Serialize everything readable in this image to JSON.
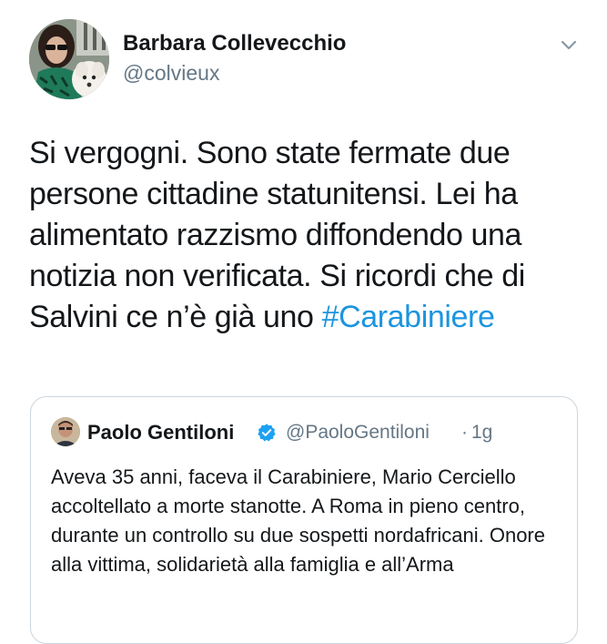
{
  "tweet": {
    "author": {
      "name": "Barbara Collevecchio",
      "handle": "@colvieux"
    },
    "text": "Si vergogni. Sono state fermate due persone cittadine statunitensi. Lei ha alimentato razzismo diffondendo una notizia non verificata. Si ricordi che di Salvini ce n’è già uno",
    "hashtag": "#Carabiniere"
  },
  "quoted_tweet": {
    "author": {
      "name": "Paolo Gentiloni",
      "handle": "@PaoloGentiloni"
    },
    "separator": "·",
    "time": "1g",
    "text": "Aveva 35 anni, faceva il Carabiniere, Mario Cerciello accoltellato a morte stanotte. A Roma in pieno centro, durante un controllo su due sospetti nordafricani. Onore alla vittima, solidarietà alla famiglia e all’Arma"
  },
  "icons": {
    "menu": "chevron-down-icon",
    "verified": "verified-badge-icon"
  },
  "colors": {
    "hashtag": "#1b95e0",
    "secondary_text": "#657786",
    "verified": "#1da1f2",
    "border": "#ccd6dd"
  }
}
